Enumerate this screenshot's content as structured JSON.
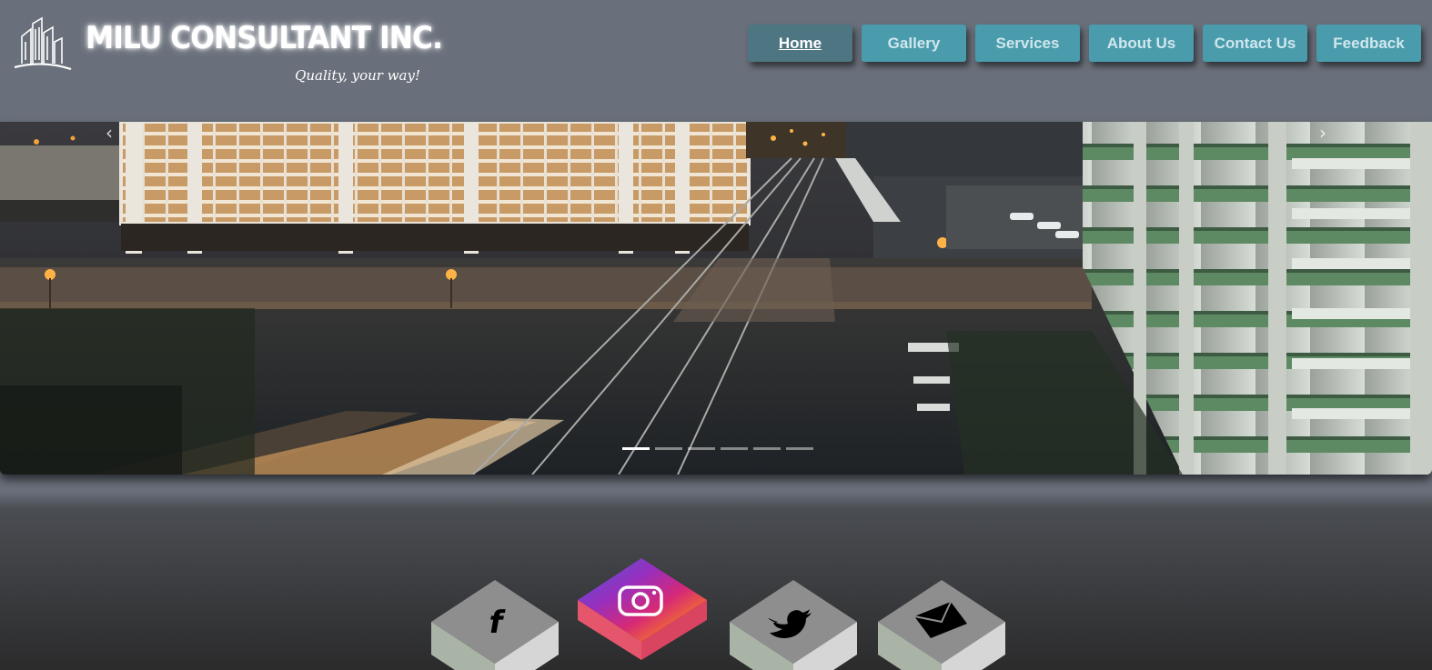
{
  "brand": {
    "name": "MILU CONSULTANT INC.",
    "tagline": "Quality, your way!",
    "logo_icon": "city-buildings-icon"
  },
  "nav": {
    "items": [
      {
        "label": "Home",
        "active": true
      },
      {
        "label": "Gallery",
        "active": false
      },
      {
        "label": "Services",
        "active": false
      },
      {
        "label": "About Us",
        "active": false
      },
      {
        "label": "Contact Us",
        "active": false
      },
      {
        "label": "Feedback",
        "active": false
      }
    ]
  },
  "slider": {
    "prev_icon": "chevron-left-icon",
    "next_icon": "chevron-right-icon",
    "prev_glyph": "‹",
    "next_glyph": "›",
    "slide_count": 6,
    "active_index": 0,
    "image": "night-railway-city-scene"
  },
  "social": [
    {
      "name": "facebook",
      "icon": "facebook-icon",
      "glyph": "f"
    },
    {
      "name": "instagram",
      "icon": "instagram-icon"
    },
    {
      "name": "twitter",
      "icon": "twitter-icon"
    },
    {
      "name": "email",
      "icon": "envelope-icon"
    }
  ],
  "colors": {
    "nav_button": "#4a9bab",
    "nav_active": "#4e7682",
    "header_bg": "#6a707b",
    "instagram_gradient": [
      "#4f5bd5",
      "#962fbf",
      "#d62976",
      "#fa7e1e",
      "#feda75"
    ]
  }
}
